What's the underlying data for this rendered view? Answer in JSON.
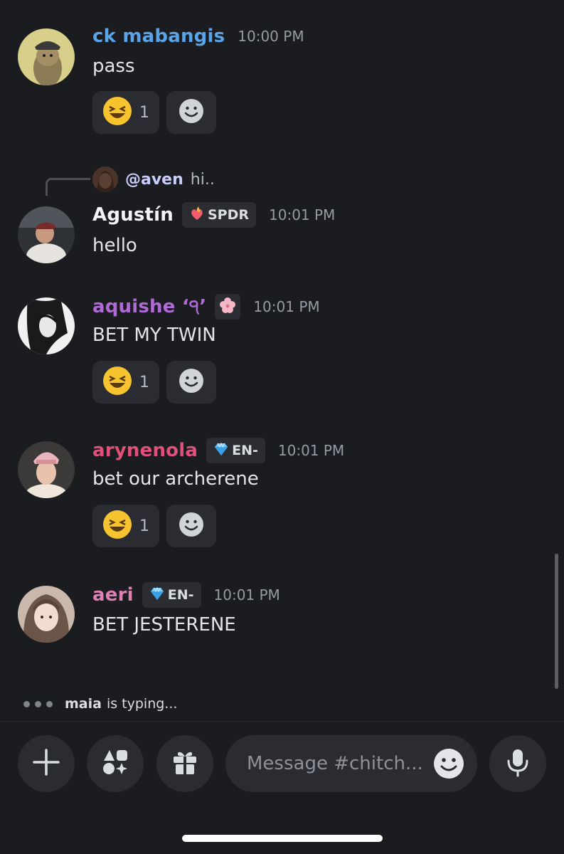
{
  "messages": [
    {
      "username": "ck mabangis",
      "name_color": "#5aa3e6",
      "time": "10:00 PM",
      "text": "pass",
      "reactions": [
        {
          "emoji": "laughing-face",
          "count": "1"
        }
      ]
    },
    {
      "reply": {
        "mention": "@aven",
        "text": "hi.."
      },
      "username": "Agustín",
      "name_color": "#f2f3f5",
      "tag": "SPDR",
      "tag_icon": "fire-heart",
      "time": "10:01 PM",
      "text": "hello"
    },
    {
      "username": "aquishe ʻ੧ʼ",
      "name_color": "#b06ad6",
      "tag_icon": "cherry-blossom",
      "time": "10:01 PM",
      "text": "BET MY TWIN",
      "reactions": [
        {
          "emoji": "laughing-face",
          "count": "1"
        }
      ]
    },
    {
      "username": "arynenola",
      "name_color": "#e0507a",
      "tag": "EN-",
      "tag_icon": "gem",
      "time": "10:01 PM",
      "text": "bet our archerene",
      "reactions": [
        {
          "emoji": "laughing-face",
          "count": "1"
        }
      ]
    },
    {
      "username": "aeri",
      "name_color": "#e07fb2",
      "tag": "EN-",
      "tag_icon": "gem",
      "time": "10:01 PM",
      "text": "BET JESTERENE"
    }
  ],
  "typing": {
    "user": "maia",
    "text": "is typing..."
  },
  "composer": {
    "placeholder": "Message #chitch..."
  },
  "colors": {
    "background": "#1b1c20",
    "surface": "#2a2c31",
    "muted": "#949ba4"
  }
}
